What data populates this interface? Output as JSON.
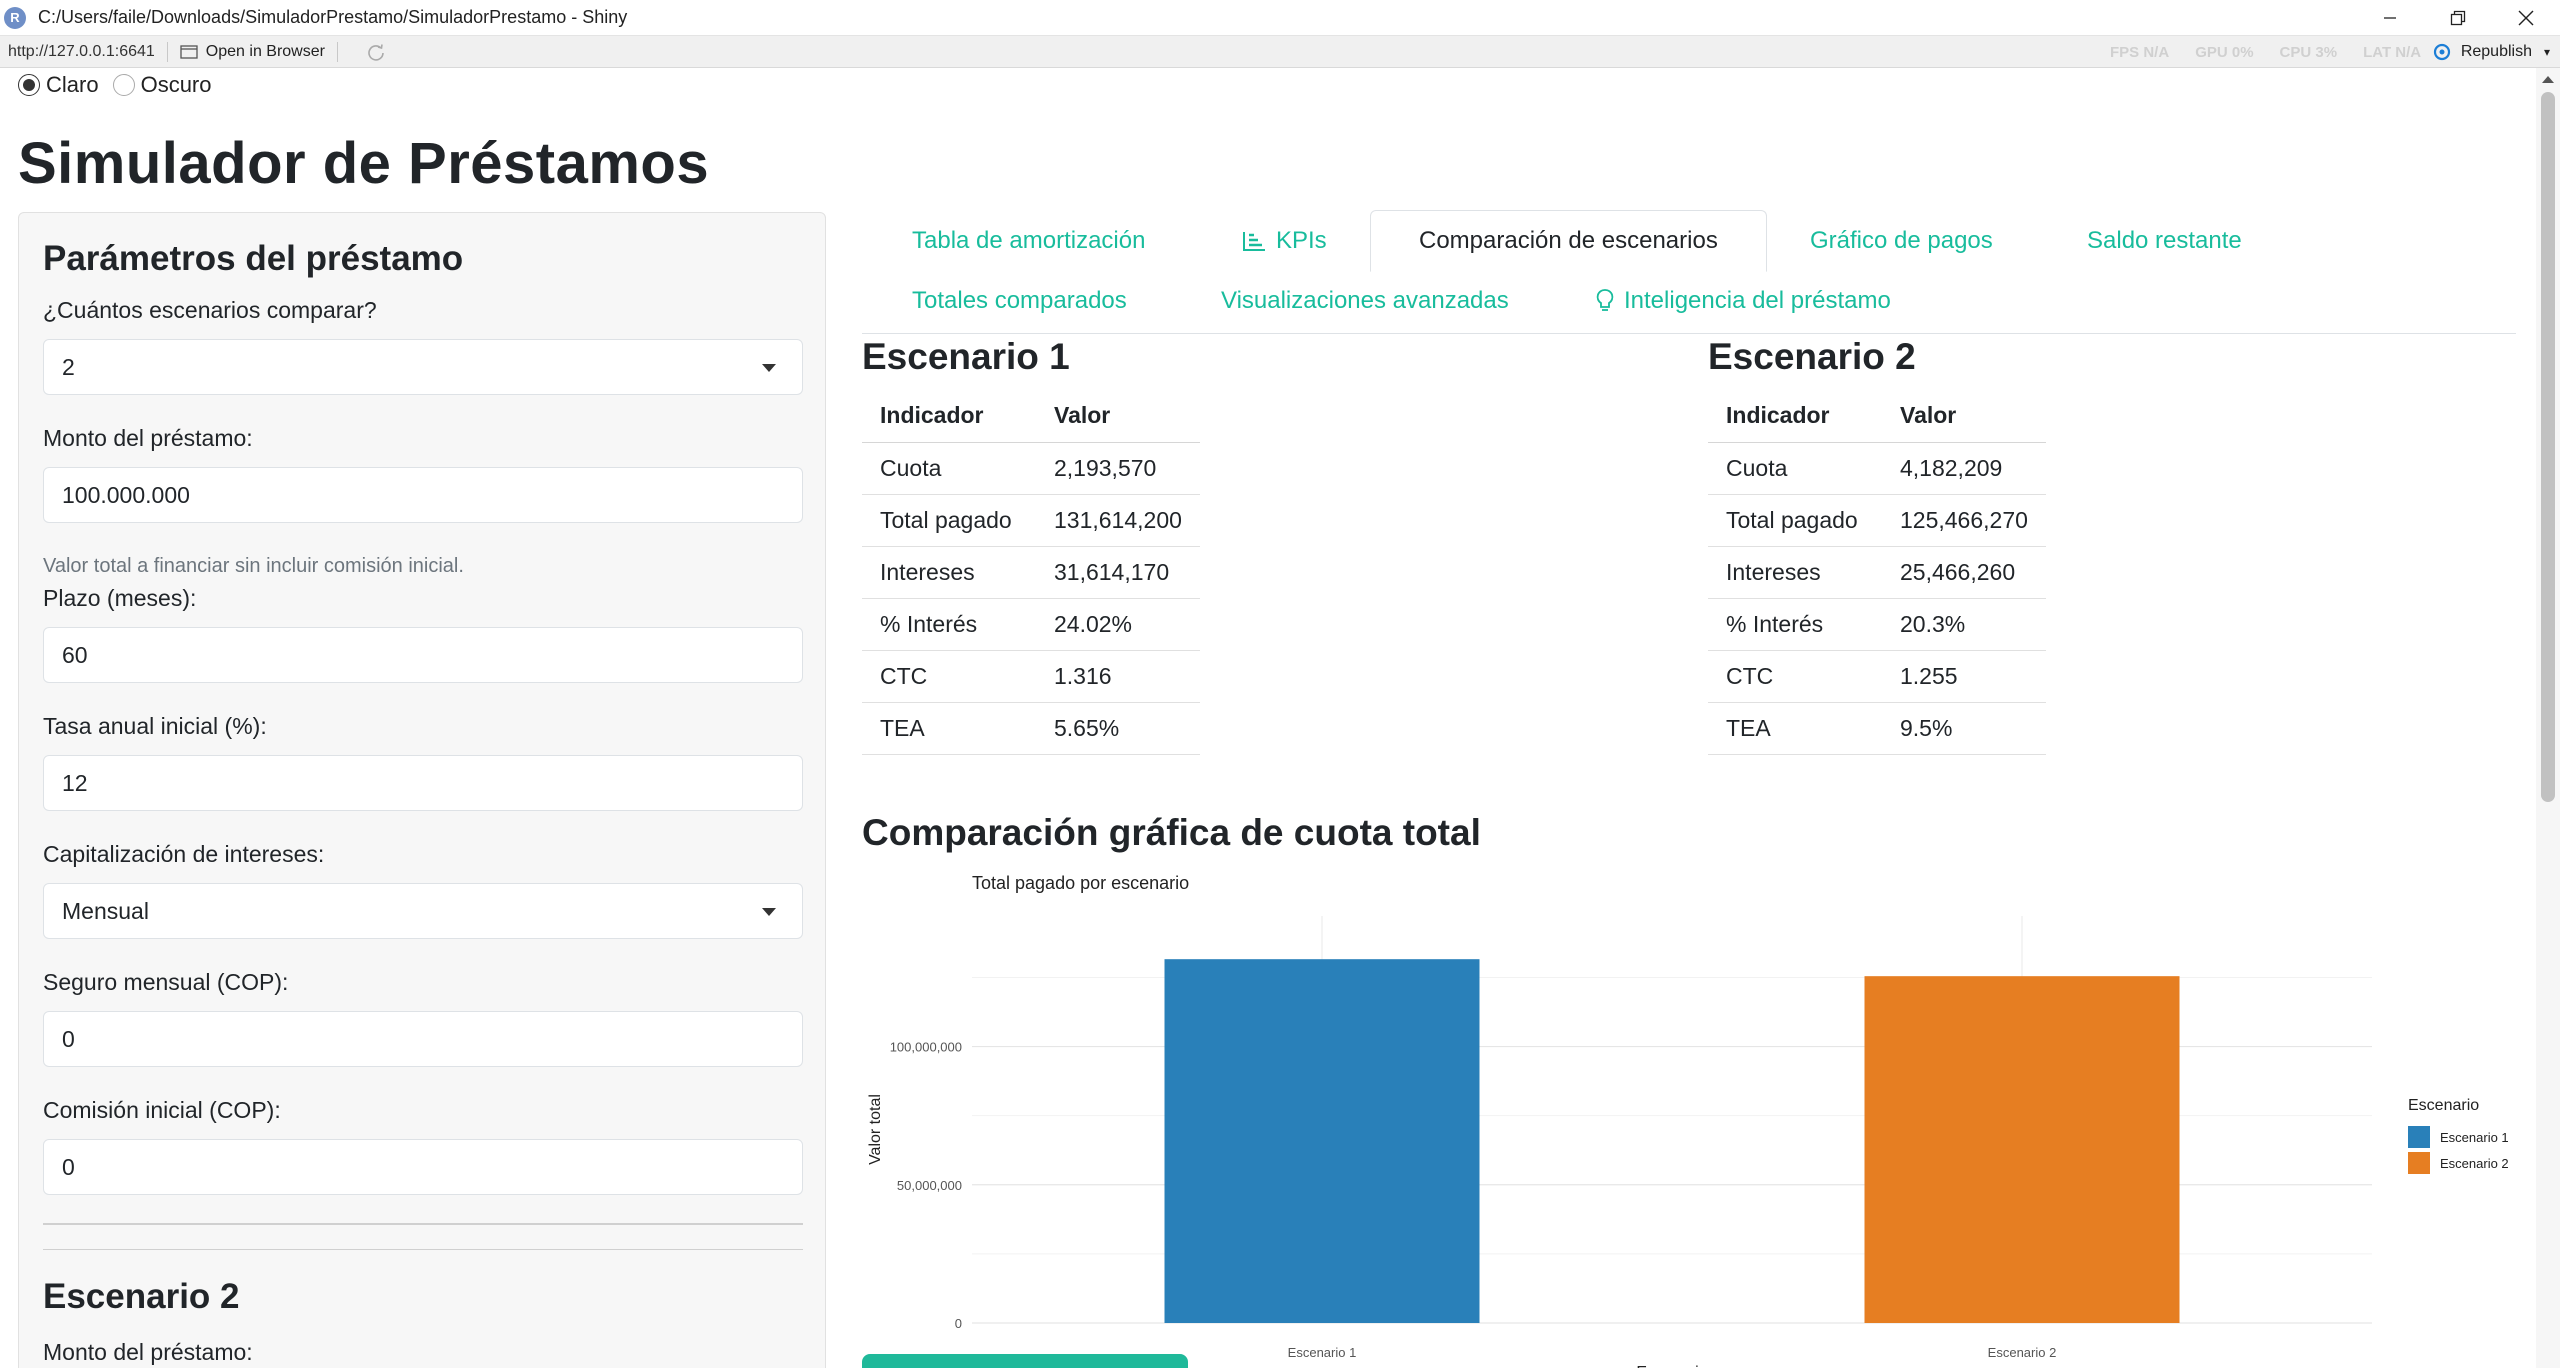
{
  "window": {
    "title": "C:/Users/faile/Downloads/SimuladorPrestamo/SimuladorPrestamo - Shiny",
    "app_icon_letter": "R"
  },
  "addressbar": {
    "url": "http://127.0.0.1:6641",
    "open_in_browser": "Open in Browser",
    "stats": {
      "fps": "FPS N/A",
      "gpu": "GPU 0%",
      "cpu": "CPU 3%",
      "lat": "LAT N/A"
    },
    "republish": "Republish"
  },
  "theme": {
    "options": [
      "Claro",
      "Oscuro"
    ],
    "selected": "Claro"
  },
  "app_title": "Simulador de Préstamos",
  "sidebar": {
    "heading": "Parámetros del préstamo",
    "scenarios_label": "¿Cuántos escenarios comparar?",
    "scenarios_value": "2",
    "amount_label": "Monto del préstamo:",
    "amount_value": "100.000.000",
    "amount_help": "Valor total a financiar sin incluir comisión inicial.",
    "term_label": "Plazo (meses):",
    "term_value": "60",
    "rate_label": "Tasa anual inicial (%):",
    "rate_value": "12",
    "cap_label": "Capitalización de intereses:",
    "cap_value": "Mensual",
    "insurance_label": "Seguro mensual (COP):",
    "insurance_value": "0",
    "commission_label": "Comisión inicial (COP):",
    "commission_value": "0",
    "scenario2_heading": "Escenario 2",
    "scenario2_amount_label": "Monto del préstamo:"
  },
  "tabs": [
    {
      "label": "Tabla de amortización"
    },
    {
      "label": "KPIs",
      "icon": "bar-chart-icon"
    },
    {
      "label": "Comparación de escenarios",
      "active": true
    },
    {
      "label": "Gráfico de pagos"
    },
    {
      "label": "Saldo restante"
    },
    {
      "label": "Totales comparados"
    },
    {
      "label": "Visualizaciones avanzadas"
    },
    {
      "label": "Inteligencia del préstamo",
      "icon": "lightbulb-icon"
    }
  ],
  "scenarios": [
    {
      "title": "Escenario 1",
      "headers": [
        "Indicador",
        "Valor"
      ],
      "rows": [
        [
          "Cuota",
          "2,193,570"
        ],
        [
          "Total pagado",
          "131,614,200"
        ],
        [
          "Intereses",
          "31,614,170"
        ],
        [
          "% Interés",
          "24.02%"
        ],
        [
          "CTC",
          "1.316"
        ],
        [
          "TEA",
          "5.65%"
        ]
      ]
    },
    {
      "title": "Escenario 2",
      "headers": [
        "Indicador",
        "Valor"
      ],
      "rows": [
        [
          "Cuota",
          "4,182,209"
        ],
        [
          "Total pagado",
          "125,466,270"
        ],
        [
          "Intereses",
          "25,466,260"
        ],
        [
          "% Interés",
          "20.3%"
        ],
        [
          "CTC",
          "1.255"
        ],
        [
          "TEA",
          "9.5%"
        ]
      ]
    }
  ],
  "comparison_title": "Comparación gráfica de cuota total",
  "chart_data": {
    "type": "bar",
    "title": "Total pagado por escenario",
    "xlabel": "Escenario",
    "ylabel": "Valor total",
    "categories": [
      "Escenario 1",
      "Escenario 2"
    ],
    "values": [
      131614200,
      125466270
    ],
    "colors": [
      "#2980b9",
      "#e67e22"
    ],
    "ylim": [
      0,
      140000000
    ],
    "yticks": [
      0,
      50000000,
      100000000
    ],
    "ytick_labels": [
      "0",
      "50,000,000",
      "100,000,000"
    ],
    "legend": {
      "title": "Escenario",
      "entries": [
        "Escenario 1",
        "Escenario 2"
      ],
      "position": "right"
    },
    "grid": true
  },
  "colors": {
    "accent": "#18bc9c",
    "bar1": "#2980b9",
    "bar2": "#e67e22"
  }
}
